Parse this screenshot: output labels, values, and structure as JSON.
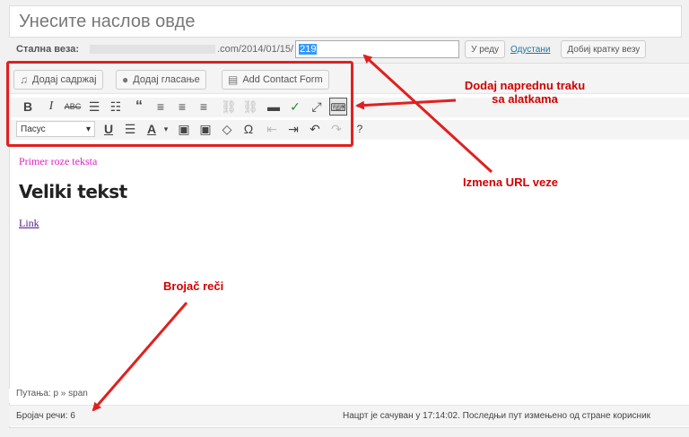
{
  "title_placeholder": "Унесите наслов овде",
  "permalink": {
    "label": "Стална веза:",
    "base": ".com/2014/01/15/",
    "slug": "219",
    "ok_label": "У реду",
    "cancel_label": "Одустани",
    "shortlink_label": "Добиј кратку везу"
  },
  "media_buttons": {
    "add_media": "Додај садржај",
    "add_poll": "Додај гласање",
    "add_contact_form": "Add Contact Form"
  },
  "toolbar": {
    "format_value": "Пасус"
  },
  "content": {
    "pink_text": "Primer roze teksta",
    "big_text": "Veliki tekst",
    "link_text": "Link"
  },
  "path": "Путања: p » span",
  "status": {
    "word_count": "Бројач речи: 6",
    "draft_message": "Нацрт је сачуван у 17:14:02. Последњи пут измењено од стране корисник"
  },
  "annotations": {
    "toolbar_note_line1": "Dodaj naprednu traku",
    "toolbar_note_line2": "sa alatkama",
    "url_note": "Izmena URL veze",
    "word_counter_note": "Brojač reči"
  },
  "colors": {
    "annotation_red": "#e02020",
    "selection_blue": "#3399ff",
    "pink_text": "#e020c0"
  }
}
